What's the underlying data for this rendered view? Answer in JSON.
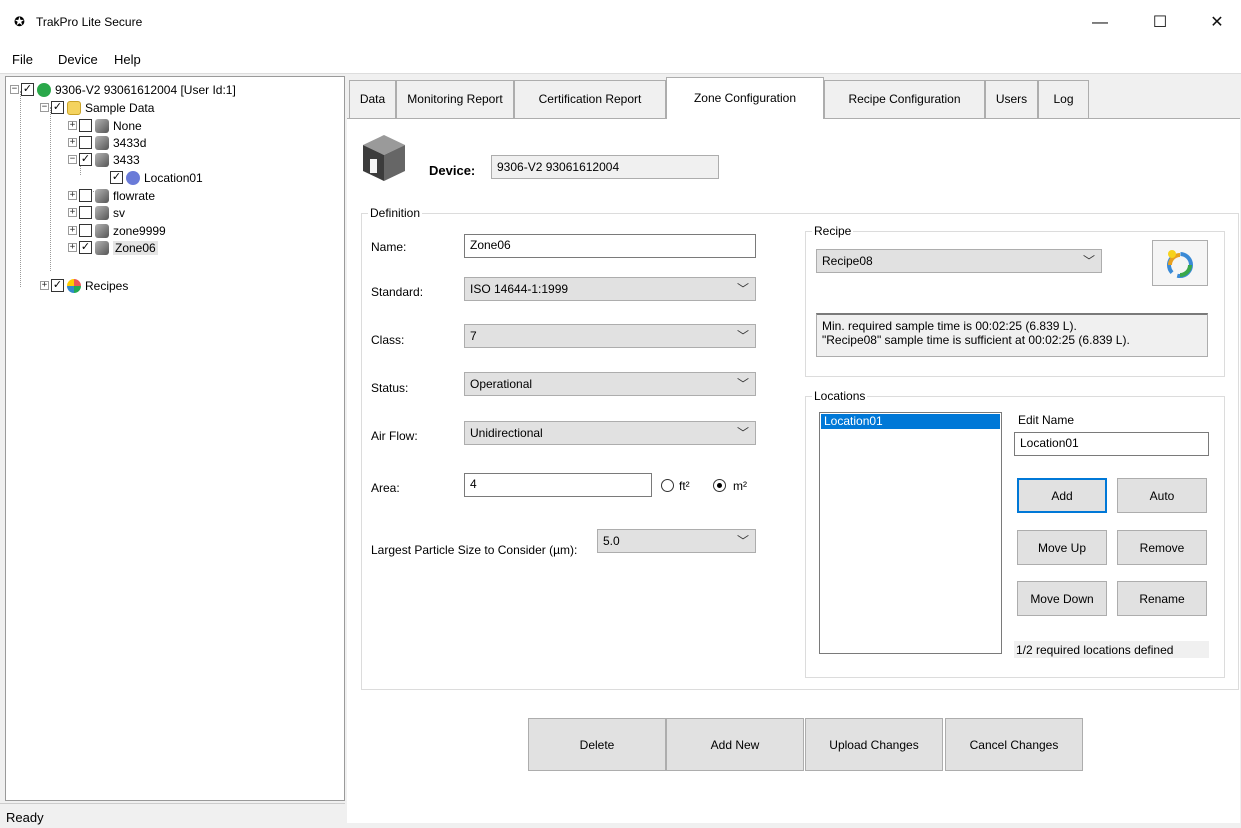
{
  "window": {
    "title": "TrakPro Lite Secure",
    "minimize": "—",
    "maximize": "☐",
    "close": "✕"
  },
  "menu": {
    "file": "File",
    "device": "Device",
    "help": "Help"
  },
  "tree": {
    "root": "9306-V2 93061612004 [User Id:1]",
    "sample_data": "Sample Data",
    "nodes": [
      "None",
      "3433d",
      "3433",
      "Location01",
      "flowrate",
      "sv",
      "zone9999",
      "Zone06"
    ],
    "recipes": "Recipes"
  },
  "status": {
    "text": "Ready"
  },
  "tabs": {
    "data": "Data",
    "monitoring": "Monitoring Report",
    "certification": "Certification Report",
    "zone": "Zone Configuration",
    "recipe": "Recipe Configuration",
    "users": "Users",
    "log": "Log"
  },
  "device": {
    "label": "Device:",
    "value": "9306-V2 93061612004"
  },
  "definition": {
    "title": "Definition",
    "name_label": "Name:",
    "name_value": "Zone06",
    "standard_label": "Standard:",
    "standard_value": "ISO 14644-1:1999",
    "class_label": "Class:",
    "class_value": "7",
    "status_label": "Status:",
    "status_value": "Operational",
    "airflow_label": "Air Flow:",
    "airflow_value": "Unidirectional",
    "area_label": "Area:",
    "area_value": "4",
    "unit_ft": "ft²",
    "unit_m": "m²",
    "particle_label": "Largest Particle Size to Consider (µm):",
    "particle_value": "5.0"
  },
  "recipe": {
    "title": "Recipe",
    "selected": "Recipe08",
    "message_line1": "Min. required sample time is 00:02:25 (6.839 L).",
    "message_line2": "\"Recipe08\" sample time is sufficient at 00:02:25 (6.839 L)."
  },
  "locations": {
    "title": "Locations",
    "items": [
      "Location01"
    ],
    "edit_name_label": "Edit Name",
    "edit_name_value": "Location01",
    "add": "Add",
    "auto": "Auto",
    "move_up": "Move Up",
    "remove": "Remove",
    "move_down": "Move Down",
    "rename": "Rename",
    "summary": "1/2 required locations defined"
  },
  "actions": {
    "delete": "Delete",
    "add_new": "Add New",
    "upload": "Upload Changes",
    "cancel": "Cancel Changes"
  },
  "colors": {
    "selection": "#0078d7",
    "window_bg": "#f0f0f0"
  }
}
